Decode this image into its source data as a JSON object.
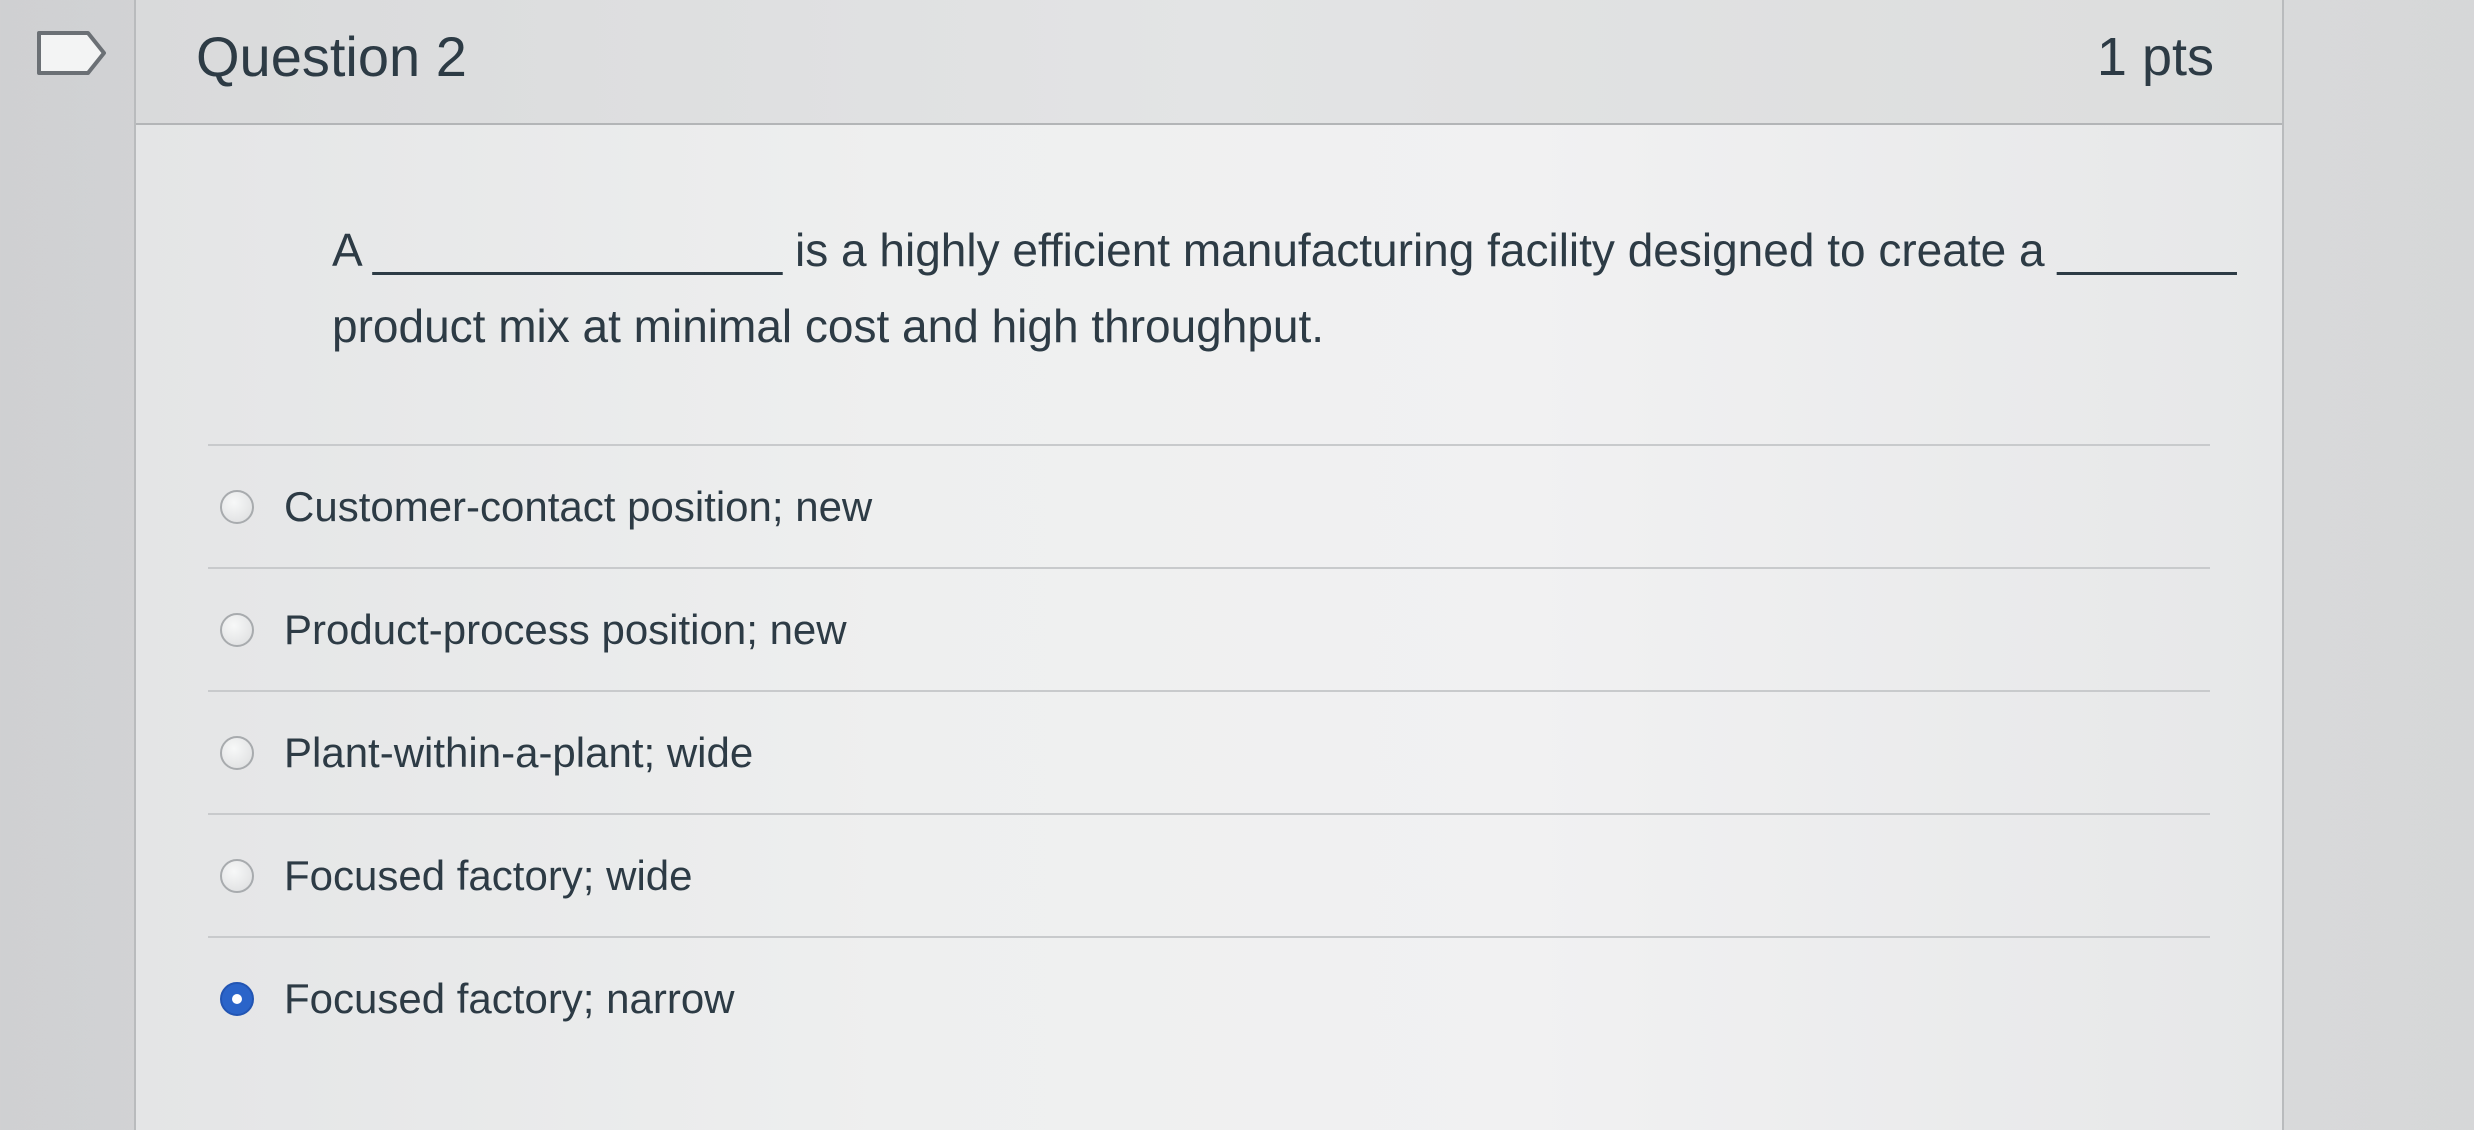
{
  "question": {
    "title": "Question 2",
    "points": "1 pts",
    "text_line1": "A ________________ is a highly efficient manufacturing facility designed to create a _______",
    "text_line2": "product mix at minimal cost and high throughput."
  },
  "answers": [
    {
      "label": "Customer-contact position; new",
      "selected": false
    },
    {
      "label": "Product-process position; new",
      "selected": false
    },
    {
      "label": "Plant-within-a-plant; wide",
      "selected": false
    },
    {
      "label": "Focused factory; wide",
      "selected": false
    },
    {
      "label": "Focused factory; narrow",
      "selected": true
    }
  ],
  "colors": {
    "text": "#2d3b45",
    "selected_radio": "#2a64c9"
  },
  "icons": {
    "flag": "bookmark-flag-icon"
  }
}
